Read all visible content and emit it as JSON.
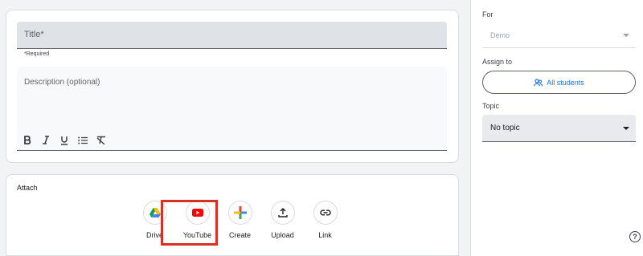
{
  "form": {
    "title_placeholder": "Title*",
    "required_note": "*Required",
    "description_placeholder": "Description (optional)",
    "format_buttons": [
      "bold-icon",
      "italic-icon",
      "underline-icon",
      "bulleted-list-icon",
      "clear-formatting-icon"
    ]
  },
  "attach": {
    "label": "Attach",
    "items": [
      {
        "label": "Drive",
        "icon": "drive-icon"
      },
      {
        "label": "YouTube",
        "icon": "youtube-icon"
      },
      {
        "label": "Create",
        "icon": "plus-icon"
      },
      {
        "label": "Upload",
        "icon": "upload-icon"
      },
      {
        "label": "Link",
        "icon": "link-icon"
      }
    ],
    "highlight_color": "#d93025"
  },
  "sidebar": {
    "for_label": "For",
    "for_value": "Demo",
    "assign_label": "Assign to",
    "assign_button": "All students",
    "topic_label": "Topic",
    "topic_value": "No topic"
  },
  "colors": {
    "accent": "#1a73e8",
    "youtube_red": "#ff0000"
  }
}
